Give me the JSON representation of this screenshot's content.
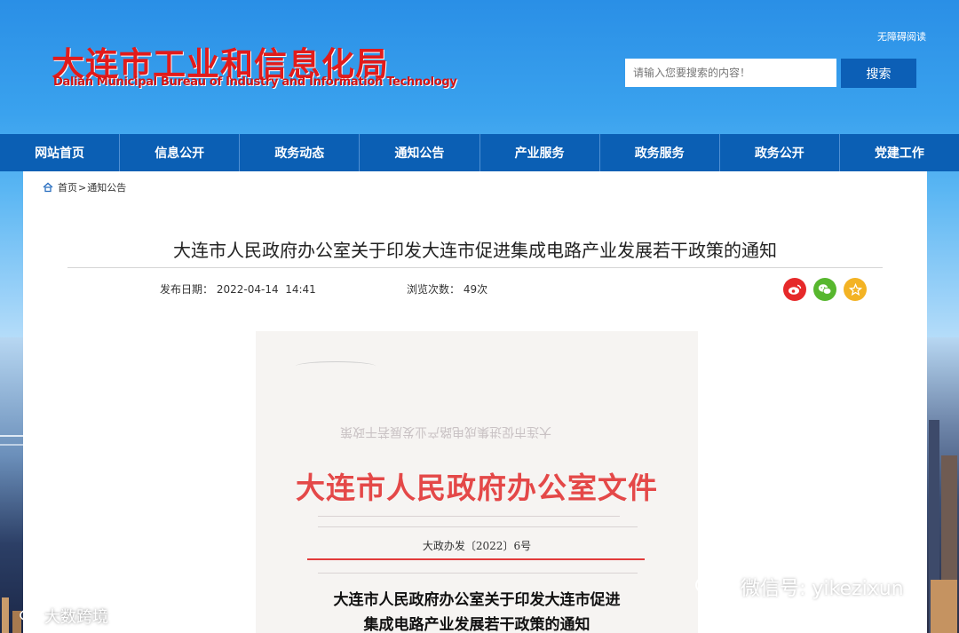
{
  "header": {
    "logo_cn": "大连市工业和信息化局",
    "logo_en": "Dalian Municipal Bureau of Industry and Information Technology",
    "accessible_link": "无障碍阅读",
    "search_placeholder": "请输入您要搜索的内容！",
    "search_button": "搜索"
  },
  "nav": {
    "items": [
      "网站首页",
      "信息公开",
      "政务动态",
      "通知公告",
      "产业服务",
      "政务服务",
      "政务公开",
      "党建工作"
    ]
  },
  "breadcrumb": {
    "home": "首页",
    "separator": ">",
    "current": "通知公告"
  },
  "article": {
    "title": "大连市人民政府办公室关于印发大连市促进集成电路产业发展若干政策的通知",
    "publish_label": "发布日期：",
    "publish_value": "2022-04-14  14:41",
    "views_label": "浏览次数：",
    "views_value": "49次",
    "share_icons": [
      "weibo-icon",
      "wechat-icon",
      "favorite-icon"
    ]
  },
  "document_image": {
    "faded_title": "大连市促进集成电路产业发展若干政策",
    "header": "大连市人民政府办公室文件",
    "number": "大政办发〔2022〕6号",
    "title_line1": "大连市人民政府办公室关于印发大连市促进",
    "title_line2": "集成电路产业发展若干政策的通知"
  },
  "watermarks": {
    "right": "微信号: yikezixun",
    "left": "大数跨境"
  },
  "colors": {
    "nav_bg": "#0b5fb4",
    "logo_red": "#e11b1b",
    "search_btn": "#0c5fb6",
    "doc_red": "#e44848"
  }
}
